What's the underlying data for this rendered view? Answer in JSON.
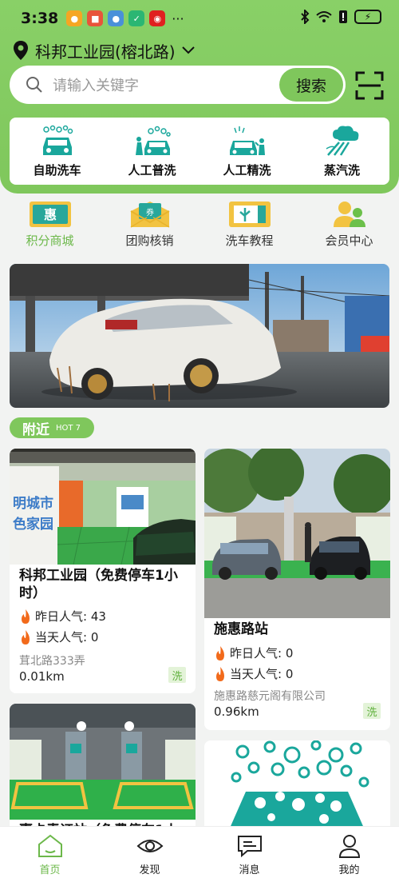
{
  "status_bar": {
    "time": "3:38",
    "more": "···"
  },
  "location": {
    "name": "科邦工业园(榕北路)"
  },
  "search": {
    "placeholder": "请输入关键字",
    "button_label": "搜索"
  },
  "services": [
    {
      "label": "自助洗车",
      "icon": "self-wash-icon"
    },
    {
      "label": "人工普洗",
      "icon": "manual-wash-icon"
    },
    {
      "label": "人工精洗",
      "icon": "fine-wash-icon"
    },
    {
      "label": "蒸汽洗",
      "icon": "steam-wash-icon"
    }
  ],
  "nav": [
    {
      "label": "积分商城",
      "icon": "points-mall-icon",
      "glyph": "惠"
    },
    {
      "label": "团购核销",
      "icon": "coupon-icon",
      "glyph": "券"
    },
    {
      "label": "洗车教程",
      "icon": "tutorial-ticket-icon"
    },
    {
      "label": "会员中心",
      "icon": "members-icon"
    }
  ],
  "nearby": {
    "title": "附近",
    "hot": "HOT 7"
  },
  "cards": [
    {
      "title_line1": "科邦工业园（免费停车1小",
      "title_line2": "时）",
      "yesterday_label": "昨日人气:",
      "yesterday_value": "43",
      "today_label": "当天人气:",
      "today_value": "0",
      "address": "茸北路333弄",
      "distance": "0.01km",
      "badge": "洗",
      "image_sign_1": "明城市",
      "image_sign_2": "色家园"
    },
    {
      "title": "施惠路站",
      "yesterday_label": "昨日人气:",
      "yesterday_value": "0",
      "today_label": "当天人气:",
      "today_value": "0",
      "address": "施惠路慈元阁有限公司",
      "distance": "0.96km",
      "badge": "洗"
    },
    {
      "title_partial": "嘉卡青证站（免费停车1小"
    }
  ],
  "tabs": [
    {
      "label": "首页",
      "icon": "home-icon",
      "active": true
    },
    {
      "label": "发现",
      "icon": "eye-icon",
      "active": false
    },
    {
      "label": "消息",
      "icon": "message-icon",
      "active": false
    },
    {
      "label": "我的",
      "icon": "profile-icon",
      "active": false
    }
  ],
  "colors": {
    "brand_green": "#7fc75c",
    "teal": "#1aa79c"
  }
}
